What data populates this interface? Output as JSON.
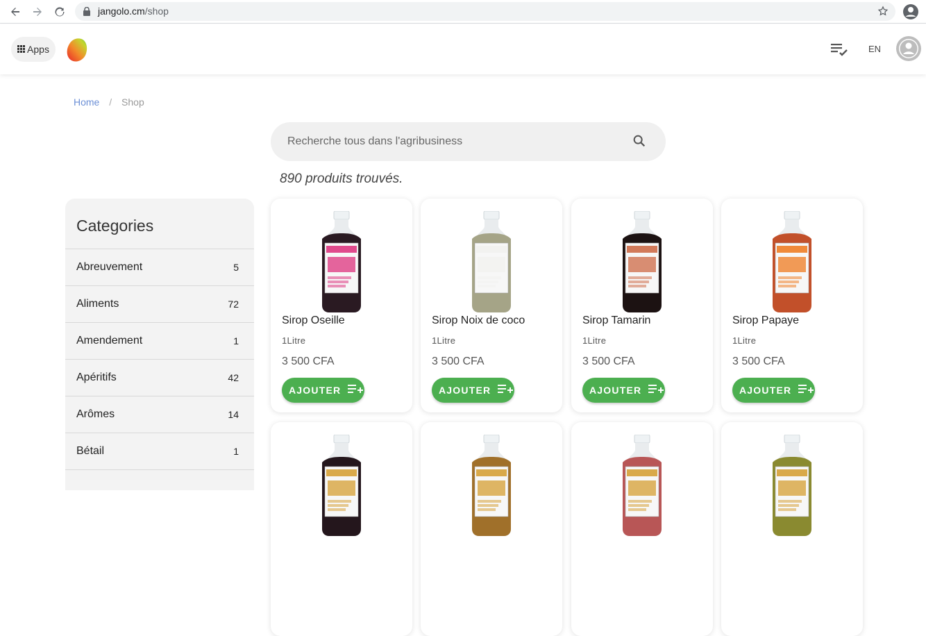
{
  "browser": {
    "url_host": "jangolo.cm",
    "url_path": "/shop"
  },
  "header": {
    "apps_label": "Apps",
    "lang_label": "EN",
    "icons": [
      "apps-grid-icon",
      "mango-logo-icon",
      "list-check-icon",
      "account-icon"
    ]
  },
  "breadcrumb": {
    "home": "Home",
    "separator": "/",
    "current": "Shop"
  },
  "search": {
    "placeholder": "Recherche tous dans l'agribusiness",
    "value": ""
  },
  "results": {
    "count_text": "890 produits trouvés."
  },
  "categories": {
    "title": "Categories",
    "items": [
      {
        "label": "Abreuvement",
        "count": "5"
      },
      {
        "label": "Aliments",
        "count": "72"
      },
      {
        "label": "Amendement",
        "count": "1"
      },
      {
        "label": "Apéritifs",
        "count": "42"
      },
      {
        "label": "Arômes",
        "count": "14"
      },
      {
        "label": "Bétail",
        "count": "1"
      }
    ]
  },
  "products": [
    {
      "name": "Sirop Oseille",
      "unit": "1Litre",
      "price": "3 500 CFA",
      "button": "AJOUTER",
      "liquid": "#2a1a22",
      "label_color": "#e04a8c",
      "label_text": "OSEILLE"
    },
    {
      "name": "Sirop Noix de coco",
      "unit": "1Litre",
      "price": "3 500 CFA",
      "button": "AJOUTER",
      "liquid": "#a5a487",
      "label_color": "#f2f2f0",
      "label_text": "NOIX DE COCO"
    },
    {
      "name": "Sirop Tamarin",
      "unit": "1Litre",
      "price": "3 500 CFA",
      "button": "AJOUTER",
      "liquid": "#1c1212",
      "label_color": "#d27a5a",
      "label_text": "TAMARIN"
    },
    {
      "name": "Sirop Papaye",
      "unit": "1Litre",
      "price": "3 500 CFA",
      "button": "AJOUTER",
      "liquid": "#c2502a",
      "label_color": "#f08a3a",
      "label_text": "PAPAYE"
    }
  ],
  "products_row2": [
    {
      "liquid": "#24161c"
    },
    {
      "liquid": "#a0702a"
    },
    {
      "liquid": "#b85656"
    },
    {
      "liquid": "#8a8a30"
    }
  ],
  "colors": {
    "accent_green": "#4caf50",
    "link_blue": "#6b8fd6"
  }
}
